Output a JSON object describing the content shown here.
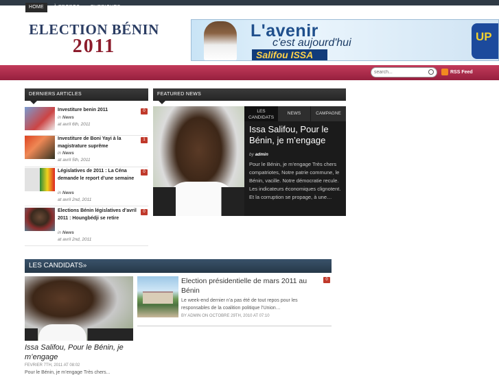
{
  "site": {
    "logo_line1": "ELECTION BÉNIN",
    "logo_line2": "2011"
  },
  "banner": {
    "headline": "L'avenir",
    "subline": "c'est aujourd'hui",
    "name": "Salifou ISSA",
    "party": "UP"
  },
  "nav": {
    "items": [
      {
        "label": "HOME"
      },
      {
        "label": "À PROPOS"
      },
      {
        "label": "RUBRIQUES"
      }
    ],
    "search_placeholder": "search...",
    "rss_label": "RSS Feed"
  },
  "sidebar": {
    "heading": "DERNIERS ARTICLES",
    "articles": [
      {
        "title": "Investiture benin 2011",
        "category": "News",
        "date": "at avril 6th, 2011",
        "comments": "0"
      },
      {
        "title": "Investiture de Boni Yayi à la magistrature suprême",
        "category": "News",
        "date": "at avril 5th, 2011",
        "comments": "1"
      },
      {
        "title": "Législatives de 2011 : La Céna demande le report d’une semaine",
        "category": "News",
        "date": "at avril 2nd, 2011",
        "comments": "0"
      },
      {
        "title": "Elections Bénin législatives d’avril 2011 : Houngbédji se retire",
        "category": "News",
        "date": "at avril 2nd, 2011",
        "comments": "0"
      }
    ],
    "in_label": "in"
  },
  "featured": {
    "heading": "FEATURED NEWS",
    "tabs": [
      {
        "label": "LES CANDIDATS"
      },
      {
        "label": "NEWS"
      },
      {
        "label": "CAMPAGNE"
      }
    ],
    "title": "Issa Salifou, Pour le Bénin, je m’engage",
    "by": "by",
    "author": "admin",
    "excerpt": "Pour le Bénin, je m’engage Très chers compatriotes, Notre patrie commune, le Bénin, vacille. Notre démocratie recule. Les indicateurs économiques clignotent. Et la corruption se propage, à une…"
  },
  "candidats": {
    "heading": "LES CANDIDATS»",
    "big": {
      "title": "Issa Salifou, Pour le Bénin, je m’engage",
      "date": "FEVRIER 7TH, 2011 AT 08:02",
      "excerpt": "Pour le Bénin, je m’engage Très chers..."
    },
    "item": {
      "title": "Election présidentielle de mars 2011 au Bénin",
      "excerpt": "Le week-end dernier n’a pas été de tout repos pour les responsables de la coalition politique l’Union…",
      "byline": "BY ADMIN ON OCTOBRE 29TH, 2010 AT 07:10",
      "comments": "0"
    }
  },
  "colors": {
    "nav_bg": "#b02d4c",
    "dark_bar": "#2f3a45",
    "badge": "#c0392b",
    "candidats_bar": "#2f4559"
  }
}
